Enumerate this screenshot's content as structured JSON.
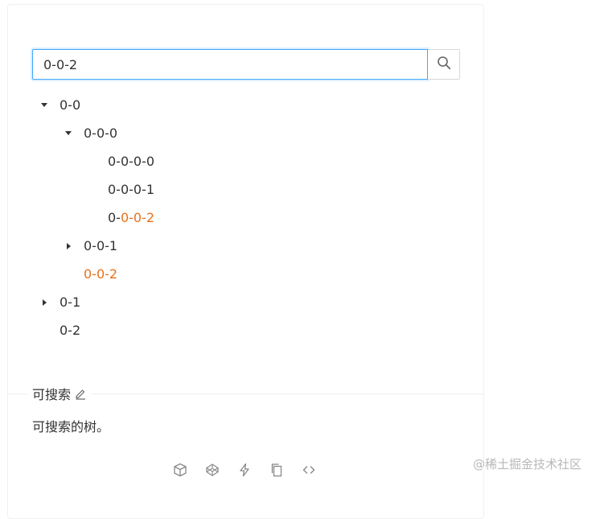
{
  "search": {
    "value": "0-0-2",
    "button_icon": "search-icon"
  },
  "tree": [
    {
      "id": "n-0-0",
      "level": 0,
      "switcher": "expanded",
      "pre": "0-0",
      "hl": "",
      "post": ""
    },
    {
      "id": "n-0-0-0",
      "level": 1,
      "switcher": "expanded",
      "pre": "0-0-0",
      "hl": "",
      "post": ""
    },
    {
      "id": "n-0-0-0-0",
      "level": 2,
      "switcher": "leaf",
      "pre": "0-0-0-0",
      "hl": "",
      "post": ""
    },
    {
      "id": "n-0-0-0-1",
      "level": 2,
      "switcher": "leaf",
      "pre": "0-0-0-1",
      "hl": "",
      "post": ""
    },
    {
      "id": "n-0-0-0-2",
      "level": 2,
      "switcher": "leaf",
      "pre": "0-",
      "hl": "0-0-2",
      "post": ""
    },
    {
      "id": "n-0-0-1",
      "level": 1,
      "switcher": "collapsed",
      "pre": "0-0-1",
      "hl": "",
      "post": ""
    },
    {
      "id": "n-0-0-2",
      "level": 1,
      "switcher": "leaf",
      "pre": "",
      "hl": "0-0-2",
      "post": ""
    },
    {
      "id": "n-0-1",
      "level": 0,
      "switcher": "collapsed",
      "pre": "0-1",
      "hl": "",
      "post": ""
    },
    {
      "id": "n-0-2",
      "level": 0,
      "switcher": "leaf",
      "pre": "0-2",
      "hl": "",
      "post": ""
    }
  ],
  "demo": {
    "title": "可搜索",
    "description": "可搜索的树。"
  },
  "actions": [
    "codesandbox-icon",
    "codepen-icon",
    "stackblitz-icon",
    "copy-icon",
    "expand-code-icon"
  ],
  "watermark": "@稀土掘金技术社区",
  "colors": {
    "highlight": "#e8711a",
    "focus_border": "#40a9ff",
    "text": "#333333"
  }
}
